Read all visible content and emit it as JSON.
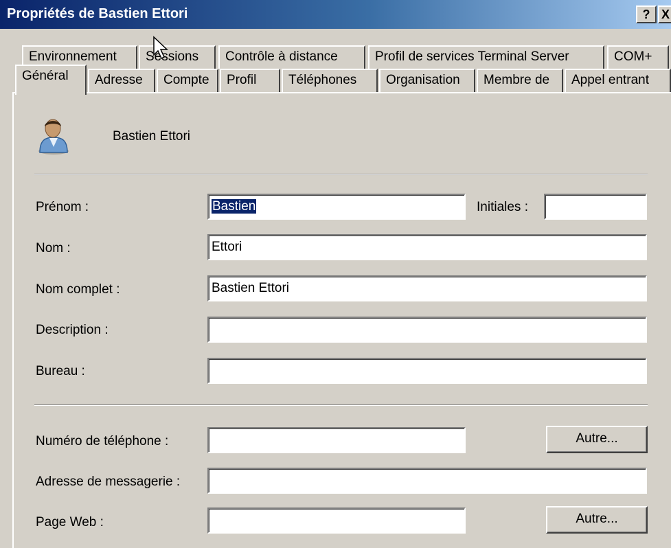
{
  "window": {
    "title": "Propriétés de Bastien Ettori",
    "help_label": "?",
    "close_label": "X"
  },
  "tabs_row1": [
    {
      "label": "Environnement"
    },
    {
      "label": "Sessions"
    },
    {
      "label": "Contrôle à distance"
    },
    {
      "label": "Profil de services Terminal Server"
    },
    {
      "label": "COM+"
    }
  ],
  "tabs_row2": [
    {
      "label": "Général",
      "active": true
    },
    {
      "label": "Adresse"
    },
    {
      "label": "Compte"
    },
    {
      "label": "Profil"
    },
    {
      "label": "Téléphones"
    },
    {
      "label": "Organisation"
    },
    {
      "label": "Membre de"
    },
    {
      "label": "Appel entrant"
    }
  ],
  "user": {
    "display_name": "Bastien Ettori",
    "icon": "user-icon"
  },
  "form": {
    "prenom_label": "Prénom :",
    "prenom_value": "Bastien",
    "initiales_label": "Initiales :",
    "initiales_value": "",
    "nom_label": "Nom :",
    "nom_value": "Ettori",
    "nom_complet_label": "Nom complet :",
    "nom_complet_value": "Bastien Ettori",
    "description_label": "Description :",
    "description_value": "",
    "bureau_label": "Bureau :",
    "bureau_value": "",
    "telephone_label": "Numéro de téléphone :",
    "telephone_value": "",
    "telephone_other_button": "Autre...",
    "email_label": "Adresse de messagerie :",
    "email_value": "",
    "web_label": "Page Web :",
    "web_value": "",
    "web_other_button": "Autre..."
  }
}
